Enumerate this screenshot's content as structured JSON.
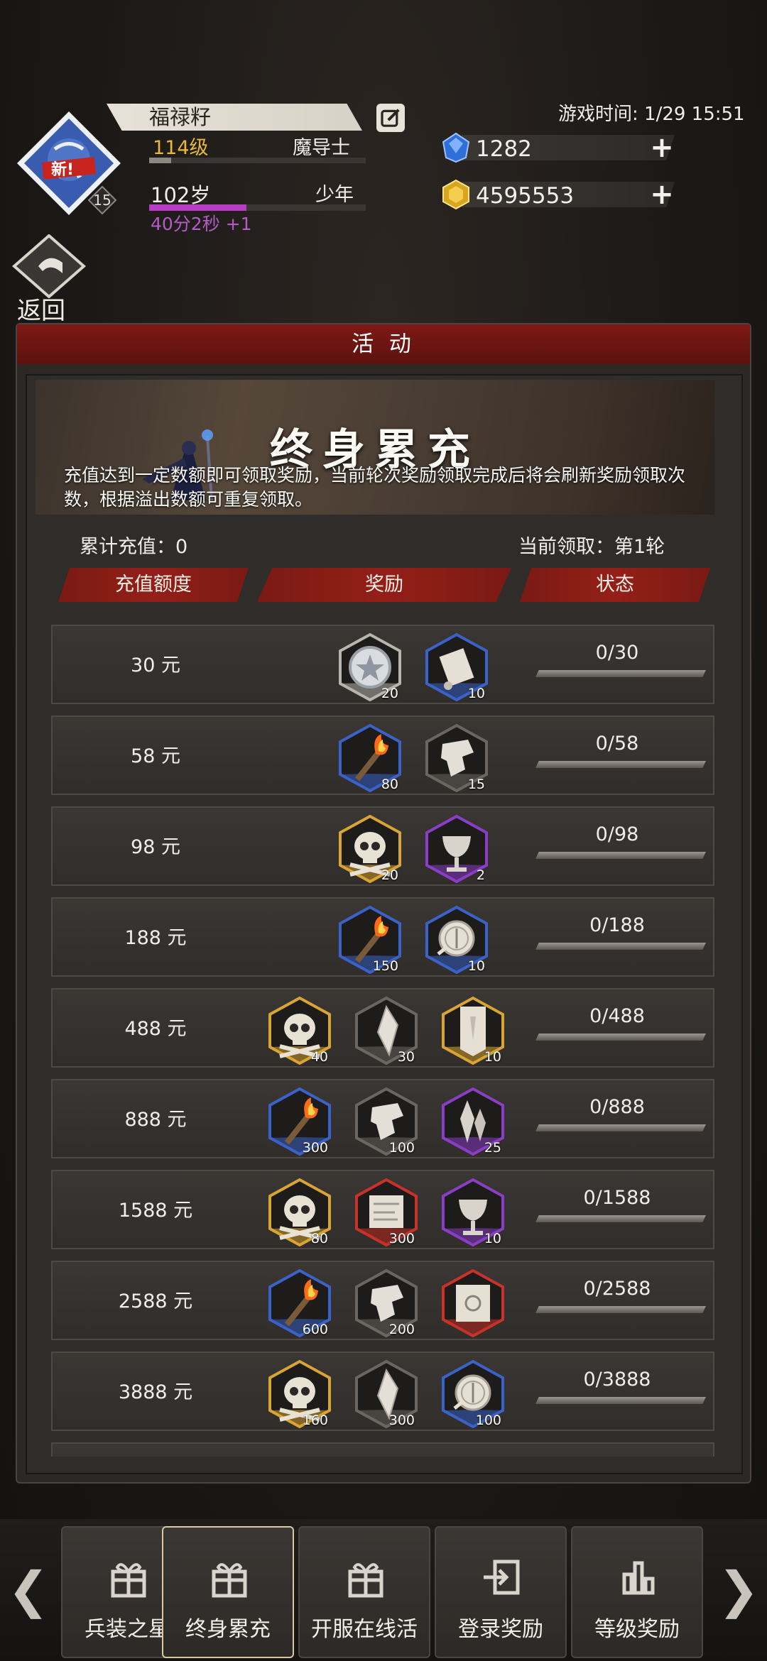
{
  "header": {
    "player_name": "福禄籽",
    "level": "114级",
    "class_name": "魔导士",
    "age": "102岁",
    "age_stage": "少年",
    "age_timer": "40分2秒 +1",
    "avatar_badge": "新!",
    "avatar_level": "15",
    "game_time_label": "游戏时间: 1/29 15:51",
    "exp_progress": 0.1,
    "age_progress": 0.45,
    "currencies": [
      {
        "icon": "blue-gem-icon",
        "value": "1282",
        "color": "#3a7fe0"
      },
      {
        "icon": "gold-coin-icon",
        "value": "4595553",
        "color": "#e0b52a"
      }
    ],
    "back_label": "返回"
  },
  "panel": {
    "title": "活 动",
    "banner_title": "终身累充",
    "banner_desc": "充值达到一定数额即可领取奖励，当前轮次奖励领取完成后将会刷新奖励领取次数，根据溢出数额可重复领取。",
    "total_recharge": "累计充值：0",
    "current_round": "当前领取：第1轮",
    "columns": [
      "充值额度",
      "奖励",
      "状态"
    ]
  },
  "rows": [
    {
      "amount": "30 元",
      "status": "0/30",
      "rewards": [
        {
          "icon": "silver-star-coin-icon",
          "count": "20",
          "frame": "#b8b4ae"
        },
        {
          "icon": "scroll-icon",
          "count": "10",
          "frame": "#3a62c8"
        }
      ]
    },
    {
      "amount": "58 元",
      "status": "0/58",
      "rewards": [
        {
          "icon": "torch-icon",
          "count": "80",
          "frame": "#3a62c8"
        },
        {
          "icon": "shard-icon",
          "count": "15",
          "frame": "#6b6661"
        }
      ]
    },
    {
      "amount": "98 元",
      "status": "0/98",
      "rewards": [
        {
          "icon": "skull-icon",
          "count": "20",
          "frame": "#d8a534"
        },
        {
          "icon": "chalice-icon",
          "count": "2",
          "frame": "#8a3ec8"
        }
      ]
    },
    {
      "amount": "188 元",
      "status": "0/188",
      "rewards": [
        {
          "icon": "torch-icon",
          "count": "150",
          "frame": "#3a62c8"
        },
        {
          "icon": "compass-icon",
          "count": "10",
          "frame": "#3a62c8"
        }
      ]
    },
    {
      "amount": "488 元",
      "status": "0/488",
      "rewards": [
        {
          "icon": "skull-icon",
          "count": "40",
          "frame": "#d8a534"
        },
        {
          "icon": "crystal-icon",
          "count": "30",
          "frame": "#6b6661"
        },
        {
          "icon": "banner-icon",
          "count": "10",
          "frame": "#d8a534"
        }
      ]
    },
    {
      "amount": "888 元",
      "status": "0/888",
      "rewards": [
        {
          "icon": "torch-icon",
          "count": "300",
          "frame": "#3a62c8"
        },
        {
          "icon": "shard-icon",
          "count": "100",
          "frame": "#6b6661"
        },
        {
          "icon": "crystals-icon",
          "count": "25",
          "frame": "#8a3ec8"
        }
      ]
    },
    {
      "amount": "1588 元",
      "status": "0/1588",
      "rewards": [
        {
          "icon": "skull-icon",
          "count": "80",
          "frame": "#d8a534"
        },
        {
          "icon": "map-icon",
          "count": "300",
          "frame": "#c8322a"
        },
        {
          "icon": "chalice-icon",
          "count": "10",
          "frame": "#8a3ec8"
        }
      ]
    },
    {
      "amount": "2588 元",
      "status": "0/2588",
      "rewards": [
        {
          "icon": "torch-icon",
          "count": "600",
          "frame": "#3a62c8"
        },
        {
          "icon": "shard-icon",
          "count": "200",
          "frame": "#6b6661"
        },
        {
          "icon": "seal-scroll-icon",
          "count": "",
          "frame": "#c8322a"
        }
      ]
    },
    {
      "amount": "3888 元",
      "status": "0/3888",
      "rewards": [
        {
          "icon": "skull-icon",
          "count": "160",
          "frame": "#d8a534"
        },
        {
          "icon": "crystal-icon",
          "count": "300",
          "frame": "#6b6661"
        },
        {
          "icon": "compass-icon",
          "count": "100",
          "frame": "#3a62c8"
        }
      ]
    }
  ],
  "tabs": [
    {
      "label": "兵装之星",
      "icon": "gift-icon",
      "active": false
    },
    {
      "label": "终身累充",
      "icon": "gift-icon",
      "active": true
    },
    {
      "label": "开服在线活",
      "icon": "gift-icon",
      "active": false
    },
    {
      "label": "登录奖励",
      "icon": "login-icon",
      "active": false
    },
    {
      "label": "等级奖励",
      "icon": "bar-chart-icon",
      "active": false
    }
  ]
}
